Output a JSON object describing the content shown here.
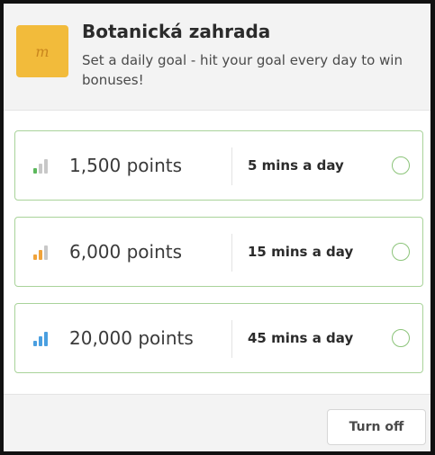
{
  "header": {
    "logo_letter": "m",
    "title": "Botanická zahrada",
    "subtitle": "Set a daily goal - hit your goal every day to win bonuses!"
  },
  "options": [
    {
      "points": "1,500 points",
      "time": "5 mins a day",
      "level": 1,
      "icon": "signal-bars-icon",
      "accent": "#5cb85c"
    },
    {
      "points": "6,000 points",
      "time": "15 mins a day",
      "level": 2,
      "icon": "signal-bars-icon",
      "accent": "#f0a33a"
    },
    {
      "points": "20,000 points",
      "time": "45 mins a day",
      "level": 3,
      "icon": "signal-bars-icon",
      "accent": "#4a9fe0"
    }
  ],
  "footer": {
    "turn_off_label": "Turn off"
  },
  "colors": {
    "option_border": "#a9d39a",
    "bar_inactive": "#c8c8c8",
    "logo_bg": "#f2bb3b"
  }
}
